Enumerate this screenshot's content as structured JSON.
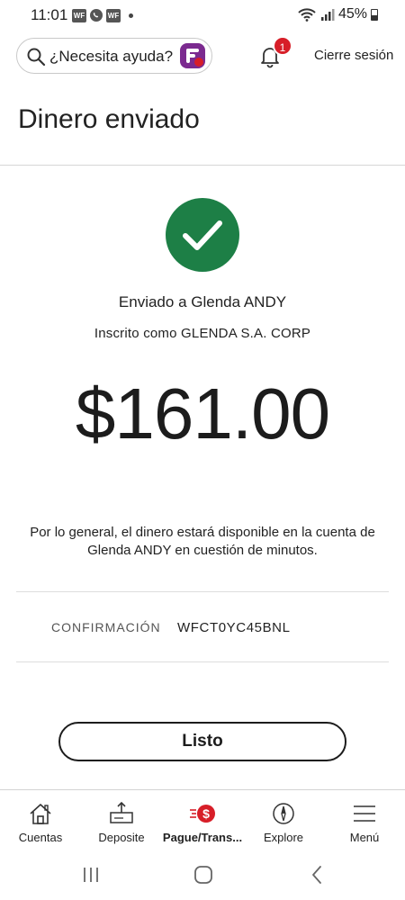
{
  "status_bar": {
    "time": "11:01",
    "notif_wf_1": "WF",
    "notif_wf_2": "WF",
    "battery": "45%"
  },
  "header": {
    "help_placeholder": "¿Necesita ayuda?",
    "notification_count": "1",
    "logout_label": "Cierre sesión"
  },
  "page": {
    "title": "Dinero enviado"
  },
  "confirmation": {
    "sent_to": "Enviado a Glenda ANDY",
    "enrolled_as": "Inscrito como GLENDA S.A. CORP",
    "amount": "$161.00",
    "availability": "Por lo general, el dinero estará disponible en la cuenta de Glenda ANDY en cuestión de minutos.",
    "confirmation_label": "CONFIRMACIÓN",
    "confirmation_number": "WFCT0YC45BNL",
    "done_label": "Listo",
    "success_color": "#1d7f46"
  },
  "tabs": [
    {
      "label": "Cuentas",
      "icon": "house-icon",
      "active": false
    },
    {
      "label": "Deposite",
      "icon": "deposit-icon",
      "active": false
    },
    {
      "label": "Pague/Trans...",
      "icon": "pay-transfer-icon",
      "active": true
    },
    {
      "label": "Explore",
      "icon": "compass-icon",
      "active": false
    },
    {
      "label": "Menú",
      "icon": "hamburger-menu-icon",
      "active": false
    }
  ],
  "colors": {
    "brand_red": "#d71e28",
    "brand_purple": "#7b2a8f"
  }
}
